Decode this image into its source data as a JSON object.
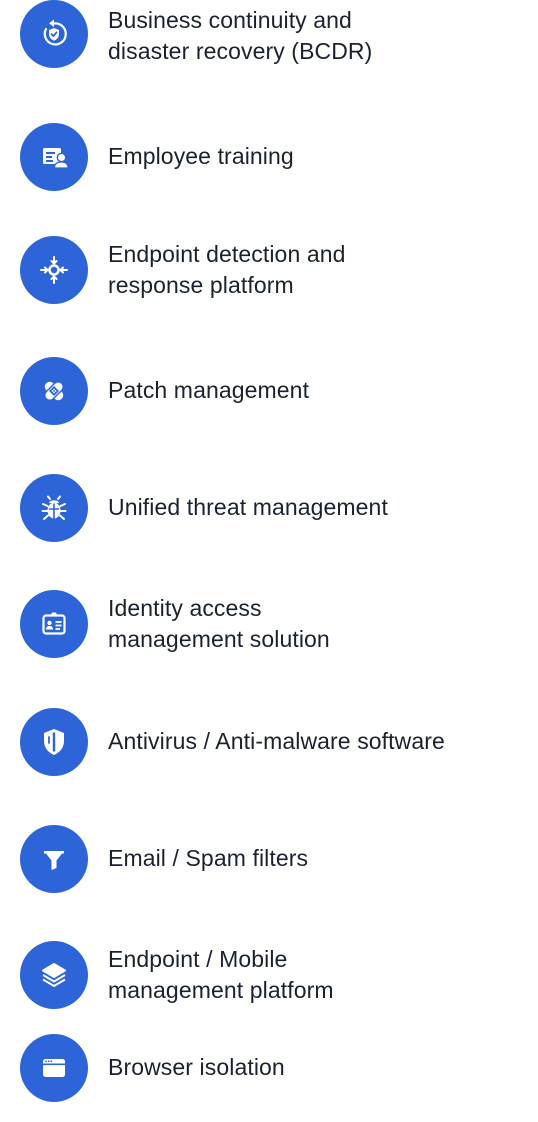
{
  "accent_color": "#2d64d8",
  "text_color": "#1a2231",
  "items": [
    {
      "icon": "shield-refresh-icon",
      "lines": [
        "Business continuity and",
        "disaster recovery (BCDR)"
      ]
    },
    {
      "icon": "training-presentation-icon",
      "lines": [
        "Employee training"
      ]
    },
    {
      "icon": "target-arrows-icon",
      "lines": [
        "Endpoint detection and",
        "response platform"
      ]
    },
    {
      "icon": "bandage-icon",
      "lines": [
        "Patch management"
      ]
    },
    {
      "icon": "bug-icon",
      "lines": [
        "Unified threat management"
      ]
    },
    {
      "icon": "id-card-icon",
      "lines": [
        "Identity access",
        "management solution"
      ]
    },
    {
      "icon": "shield-icon",
      "lines": [
        "Antivirus / Anti-malware software"
      ]
    },
    {
      "icon": "filter-icon",
      "lines": [
        "Email / Spam filters"
      ]
    },
    {
      "icon": "layers-icon",
      "lines": [
        "Endpoint / Mobile",
        "management platform"
      ]
    },
    {
      "icon": "browser-window-icon",
      "lines": [
        "Browser isolation"
      ]
    }
  ]
}
